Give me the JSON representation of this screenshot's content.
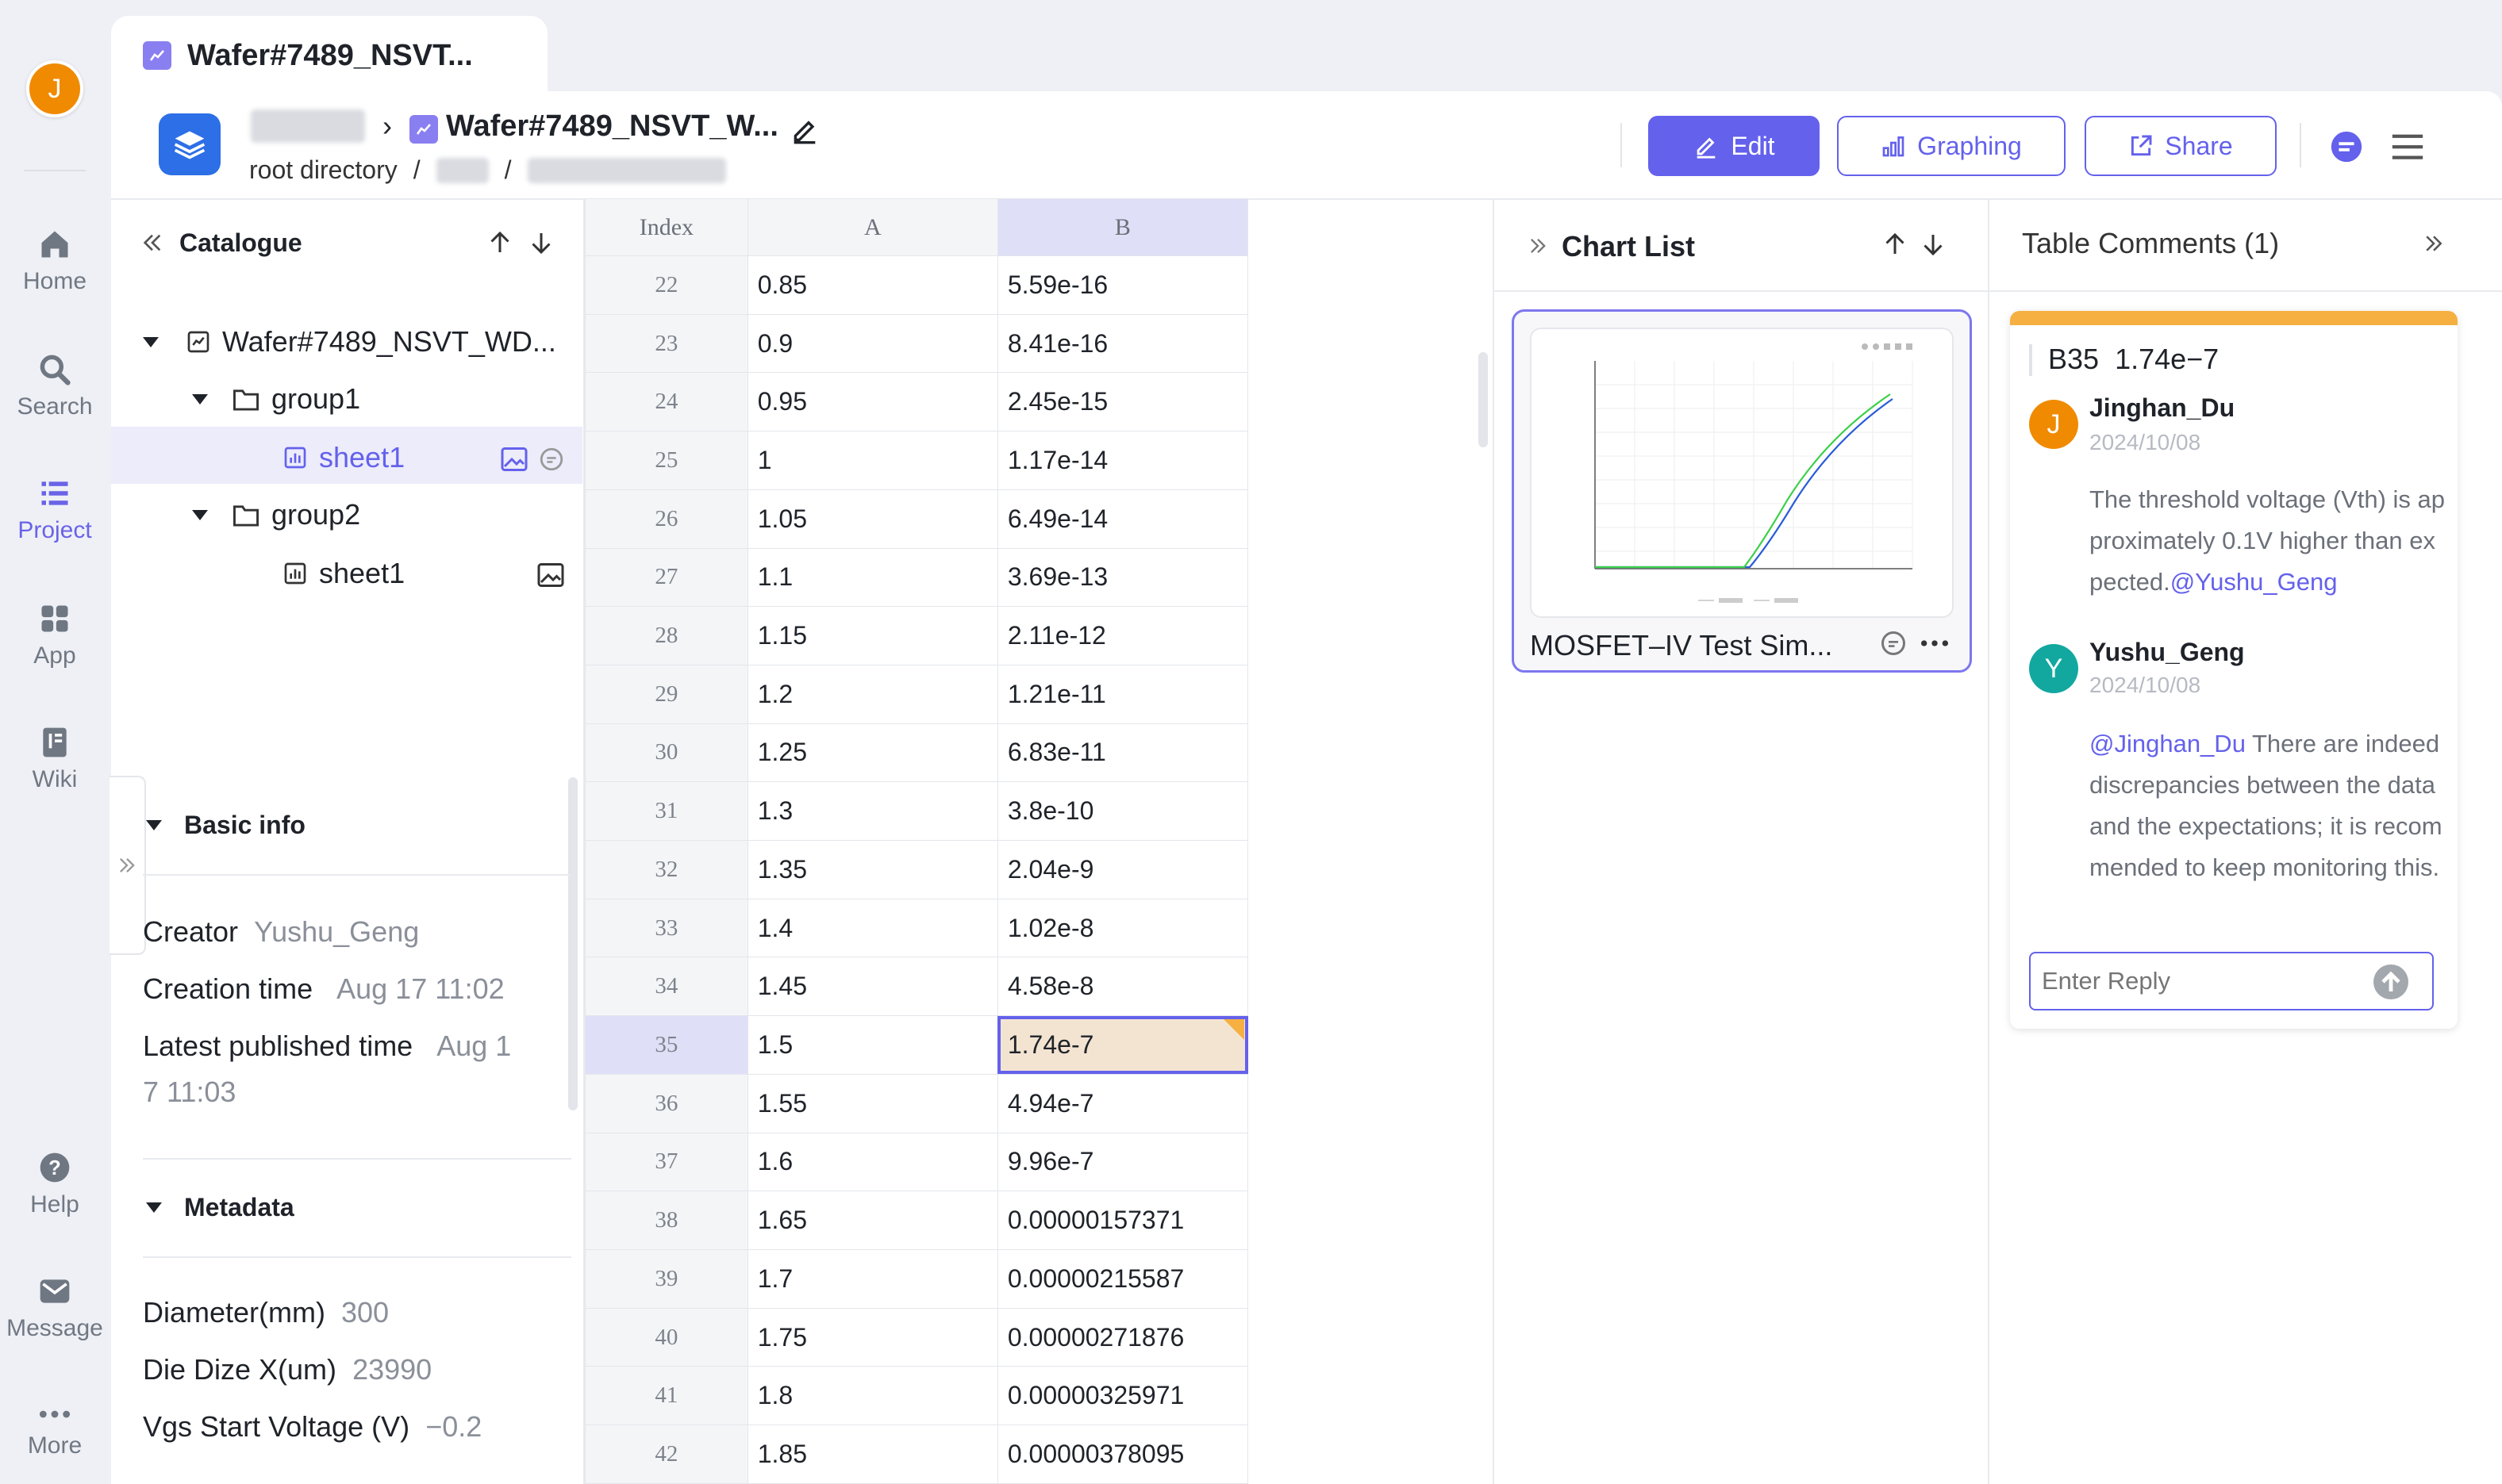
{
  "nav": {
    "avatar_letter": "J",
    "items": [
      {
        "label": "Home",
        "icon": "home-icon"
      },
      {
        "label": "Search",
        "icon": "search-icon"
      },
      {
        "label": "Project",
        "icon": "list-icon"
      },
      {
        "label": "App",
        "icon": "grid-icon"
      },
      {
        "label": "Wiki",
        "icon": "book-icon"
      },
      {
        "label": "Help",
        "icon": "help-icon"
      },
      {
        "label": "Message",
        "icon": "mail-icon"
      },
      {
        "label": "More",
        "icon": "more-icon"
      }
    ],
    "active": "Project"
  },
  "tab": {
    "title": "Wafer#7489_NSVT..."
  },
  "header": {
    "title": "Wafer#7489_NSVT_W...",
    "breadcrumb_root": "root directory",
    "breadcrumb_sep": "/",
    "edit_label": "Edit",
    "graphing_label": "Graphing",
    "share_label": "Share"
  },
  "catalogue": {
    "title": "Catalogue",
    "root": "Wafer#7489_NSVT_WD...",
    "group1": "group1",
    "group1_sheet": "sheet1",
    "group2": "group2",
    "group2_sheet": "sheet1"
  },
  "basic_info": {
    "title": "Basic info",
    "creator_label": "Creator",
    "creator_value": "Yushu_Geng",
    "creation_label": "Creation time",
    "creation_value": "Aug 17 11:02",
    "published_label": "Latest published time",
    "published_value_1": "Aug 1",
    "published_value_2": "7 11:03"
  },
  "metadata": {
    "title": "Metadata",
    "diameter_label": "Diameter(mm)",
    "diameter_value": "300",
    "die_label": "Die Dize X(um)",
    "die_value": "23990",
    "vgs_label": "Vgs Start Voltage (V)",
    "vgs_value": "−0.2"
  },
  "table": {
    "headers": [
      "Index",
      "A",
      "B"
    ],
    "selected_row": "35",
    "rows": [
      [
        "22",
        "0.85",
        "5.59e-16"
      ],
      [
        "23",
        "0.9",
        "8.41e-16"
      ],
      [
        "24",
        "0.95",
        "2.45e-15"
      ],
      [
        "25",
        "1",
        "1.17e-14"
      ],
      [
        "26",
        "1.05",
        "6.49e-14"
      ],
      [
        "27",
        "1.1",
        "3.69e-13"
      ],
      [
        "28",
        "1.15",
        "2.11e-12"
      ],
      [
        "29",
        "1.2",
        "1.21e-11"
      ],
      [
        "30",
        "1.25",
        "6.83e-11"
      ],
      [
        "31",
        "1.3",
        "3.8e-10"
      ],
      [
        "32",
        "1.35",
        "2.04e-9"
      ],
      [
        "33",
        "1.4",
        "1.02e-8"
      ],
      [
        "34",
        "1.45",
        "4.58e-8"
      ],
      [
        "35",
        "1.5",
        "1.74e-7"
      ],
      [
        "36",
        "1.55",
        "4.94e-7"
      ],
      [
        "37",
        "1.6",
        "9.96e-7"
      ],
      [
        "38",
        "1.65",
        "0.00000157371"
      ],
      [
        "39",
        "1.7",
        "0.00000215587"
      ],
      [
        "40",
        "1.75",
        "0.00000271876"
      ],
      [
        "41",
        "1.8",
        "0.00000325971"
      ],
      [
        "42",
        "1.85",
        "0.00000378095"
      ]
    ]
  },
  "chart_list": {
    "title": "Chart List",
    "card_title": "MOSFET–IV Test Sim..."
  },
  "comments": {
    "title": "Table Comments (1)",
    "cell_ref": "B35",
    "cell_value": "1.74e−7",
    "thread": [
      {
        "initial": "J",
        "name": "Jinghan_Du",
        "date": "2024/10/08",
        "text": "The threshold voltage (Vth) is approximately 0.1V higher than expected.",
        "mention": "@Yushu_Geng",
        "color": "#f08a00"
      },
      {
        "initial": "Y",
        "name": "Yushu_Geng",
        "date": "2024/10/08",
        "mention": "@Jinghan_Du",
        "text": " There are indeed discrepancies between the data and the expectations; it is recommended to keep monitoring this.",
        "color": "#12a8a0"
      }
    ],
    "reply_placeholder": "Enter Reply"
  },
  "colors": {
    "accent": "#6461ec",
    "comment_bar": "#f6b041",
    "selected_cell": "#f3e4d2"
  }
}
